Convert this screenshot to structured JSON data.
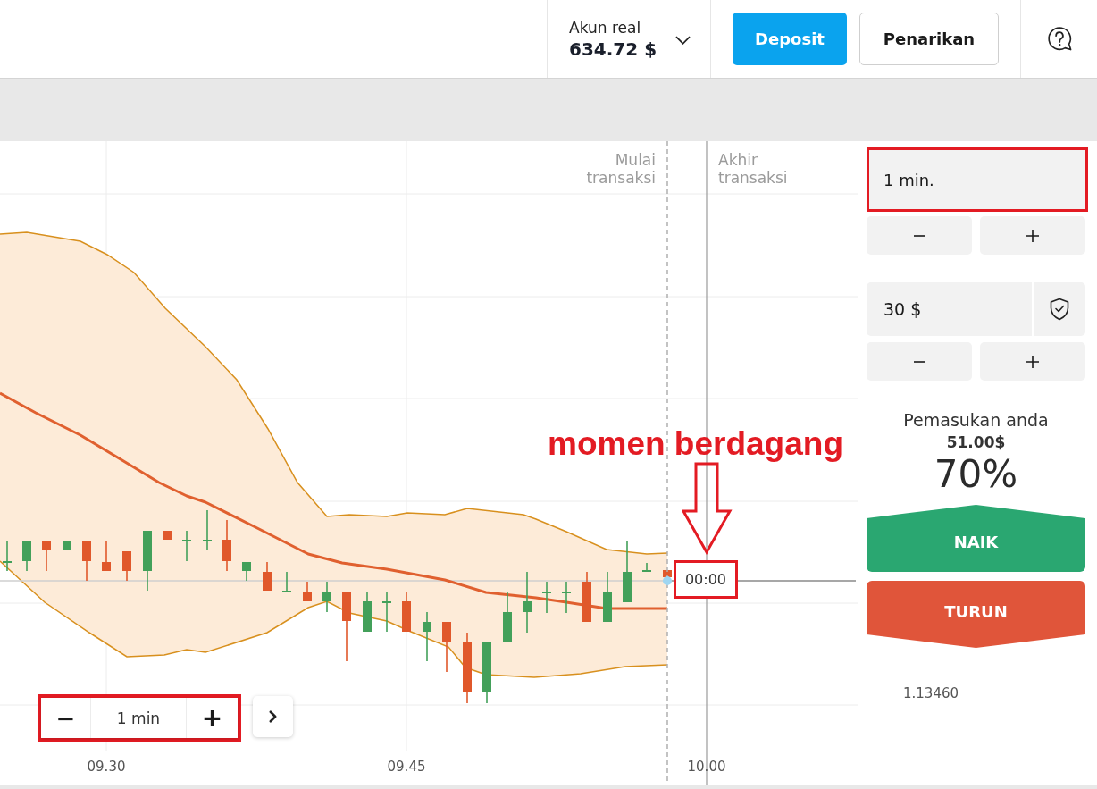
{
  "header": {
    "account": {
      "label": "Akun real",
      "balance": "634.72 $"
    },
    "buttons": [
      {
        "label": "Deposit",
        "kind": "deposit"
      },
      {
        "label": "Penarikan",
        "kind": "withdraw"
      }
    ]
  },
  "chart": {
    "start_label": "Mulai transaksi",
    "end_label": "Akhir transaksi",
    "timer": {
      "value": "00:00",
      "highlighted": true
    },
    "time_axis": [
      "09.30",
      "09.45",
      "10.00"
    ],
    "price_axis": [
      "1.13460"
    ],
    "zoom": {
      "highlighted": true,
      "items": [
        {
          "kind": "decrease",
          "label": "−"
        },
        {
          "kind": "value",
          "label": "1 min"
        },
        {
          "kind": "increase",
          "label": "+"
        }
      ]
    }
  },
  "annotation": {
    "text": "momen berdagang"
  },
  "trade_panel": {
    "duration": {
      "value": "1 min.",
      "highlighted": true
    },
    "duration_steps": [
      {
        "kind": "decrease"
      },
      {
        "kind": "increase"
      }
    ],
    "amount": "30 $",
    "amount_steps": [
      {
        "kind": "decrease"
      },
      {
        "kind": "increase"
      }
    ],
    "income_label": "Pemasukan anda",
    "income_value": "51.00$",
    "payout": "70%",
    "actions": [
      {
        "label": "NAIK",
        "kind": "up"
      },
      {
        "label": "TURUN",
        "kind": "down"
      }
    ]
  }
}
